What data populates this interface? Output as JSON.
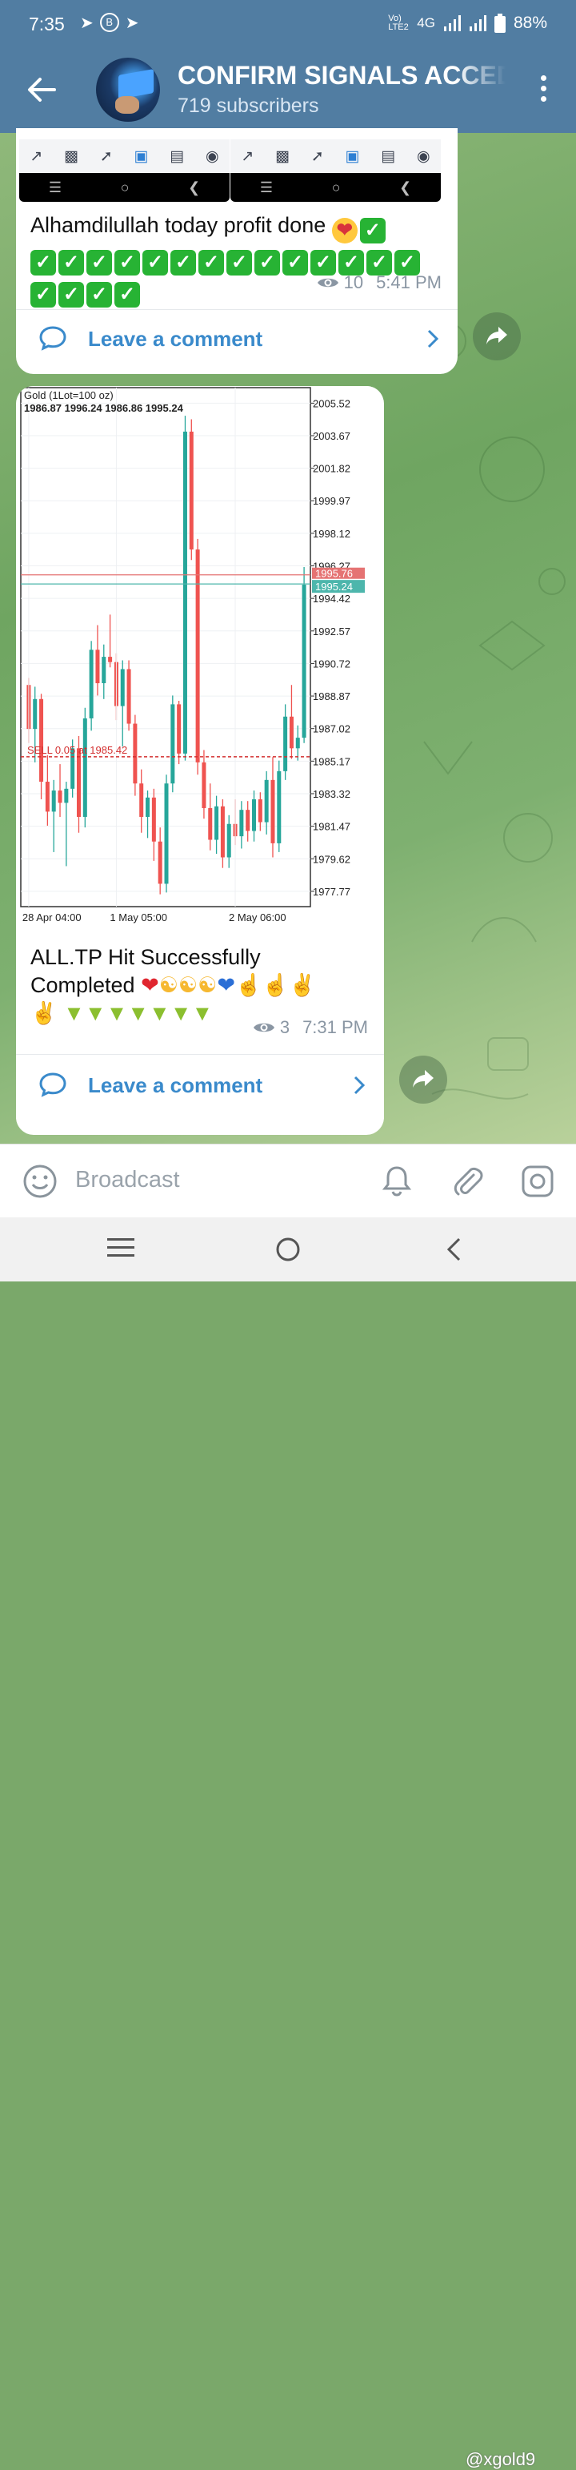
{
  "status_bar": {
    "time": "7:35",
    "network": "4G",
    "volte": "Vo) LTE2",
    "battery": "88%"
  },
  "header": {
    "title": "CONFIRM SIGNALS ACCEDED",
    "subtitle": "719 subscribers"
  },
  "messages": [
    {
      "text": "Alhamdilullah today profit done",
      "check_count_line1": 1,
      "check_count_line2": 14,
      "check_count_line3": 4,
      "views": "10",
      "time": "5:41 PM",
      "comment_label": "Leave a comment"
    },
    {
      "text_line1": "ALL.TP Hit Successfully",
      "text_line2": "Completed",
      "views": "3",
      "time": "7:31 PM",
      "comment_label": "Leave a comment"
    }
  ],
  "chart_data": {
    "type": "candlestick",
    "title": "Gold (1Lot=100 oz)",
    "ohlc_header": "1986.87 1996.24 1986.86 1995.24",
    "y_ticks": [
      "2005.52",
      "2003.67",
      "2001.82",
      "1999.97",
      "1998.12",
      "1996.27",
      "1994.42",
      "1992.57",
      "1990.72",
      "1988.87",
      "1987.02",
      "1985.17",
      "1983.32",
      "1981.47",
      "1979.62",
      "1977.77"
    ],
    "x_ticks": [
      "28 Apr 04:00",
      "1 May 05:00",
      "2 May 06:00"
    ],
    "ylim": [
      1976.9,
      2006.4
    ],
    "price_labels": {
      "ask": "1995.76",
      "bid": "1995.24"
    },
    "order_line": {
      "label": "SELL 0.05 at 1985.42",
      "price": 1985.42
    },
    "candles": [
      [
        1989.5,
        1989.9,
        1986.2,
        1987.0
      ],
      [
        1987.0,
        1989.4,
        1985.1,
        1988.7
      ],
      [
        1988.7,
        1989.0,
        1983.0,
        1984.0
      ],
      [
        1984.0,
        1985.5,
        1981.5,
        1982.3
      ],
      [
        1982.3,
        1984.1,
        1980.0,
        1983.5
      ],
      [
        1983.5,
        1985.0,
        1982.0,
        1982.8
      ],
      [
        1982.8,
        1984.0,
        1979.2,
        1983.6
      ],
      [
        1983.6,
        1986.4,
        1983.1,
        1985.9
      ],
      [
        1985.9,
        1986.6,
        1981.1,
        1982.0
      ],
      [
        1982.0,
        1988.2,
        1981.4,
        1987.6
      ],
      [
        1987.6,
        1992.0,
        1986.9,
        1991.5
      ],
      [
        1991.5,
        1992.9,
        1988.9,
        1989.6
      ],
      [
        1989.6,
        1991.8,
        1988.7,
        1991.1
      ],
      [
        1991.1,
        1993.5,
        1990.5,
        1990.8
      ],
      [
        1990.8,
        1991.3,
        1987.5,
        1988.3
      ],
      [
        1988.3,
        1990.9,
        1986.0,
        1990.4
      ],
      [
        1990.4,
        1990.9,
        1986.9,
        1987.3
      ],
      [
        1987.3,
        1987.8,
        1983.2,
        1983.9
      ],
      [
        1983.9,
        1984.7,
        1981.1,
        1982.0
      ],
      [
        1982.0,
        1983.5,
        1980.8,
        1983.1
      ],
      [
        1983.1,
        1983.6,
        1979.5,
        1980.6
      ],
      [
        1980.6,
        1981.4,
        1977.6,
        1978.2
      ],
      [
        1978.2,
        1984.4,
        1977.7,
        1983.9
      ],
      [
        1983.9,
        1988.9,
        1983.4,
        1988.4
      ],
      [
        1988.4,
        1988.6,
        1985.0,
        1985.6
      ],
      [
        1985.6,
        2004.8,
        1985.2,
        2003.9
      ],
      [
        2003.9,
        2004.6,
        1996.6,
        1997.2
      ],
      [
        1997.2,
        1997.8,
        1984.4,
        1985.1
      ],
      [
        1985.1,
        1985.8,
        1981.9,
        1982.5
      ],
      [
        1982.5,
        1983.9,
        1980.1,
        1980.7
      ],
      [
        1980.7,
        1983.2,
        1979.9,
        1982.6
      ],
      [
        1982.6,
        1983.0,
        1979.1,
        1979.7
      ],
      [
        1979.7,
        1982.1,
        1979.1,
        1981.6
      ],
      [
        1981.6,
        1983.0,
        1980.4,
        1980.9
      ],
      [
        1980.9,
        1982.9,
        1980.2,
        1982.4
      ],
      [
        1982.4,
        1982.9,
        1980.6,
        1981.2
      ],
      [
        1981.2,
        1983.5,
        1980.6,
        1983.0
      ],
      [
        1983.0,
        1983.4,
        1981.2,
        1981.7
      ],
      [
        1981.7,
        1984.6,
        1981.0,
        1984.1
      ],
      [
        1984.1,
        1985.4,
        1979.7,
        1980.5
      ],
      [
        1980.5,
        1985.2,
        1980.0,
        1984.6
      ],
      [
        1984.6,
        1988.4,
        1984.1,
        1987.7
      ],
      [
        1987.7,
        1989.5,
        1985.3,
        1985.9
      ],
      [
        1985.9,
        1987.2,
        1985.2,
        1986.5
      ],
      [
        1986.5,
        1996.2,
        1986.2,
        1995.2
      ]
    ],
    "colors": {
      "bull": "#26a69a",
      "bear": "#ef5350",
      "ask_line": "#e57373",
      "bid_line": "#4db6ac",
      "order": "#d32f2f"
    }
  },
  "bottom_bar": {
    "placeholder": "Broadcast"
  },
  "watermark": "@xgold9"
}
